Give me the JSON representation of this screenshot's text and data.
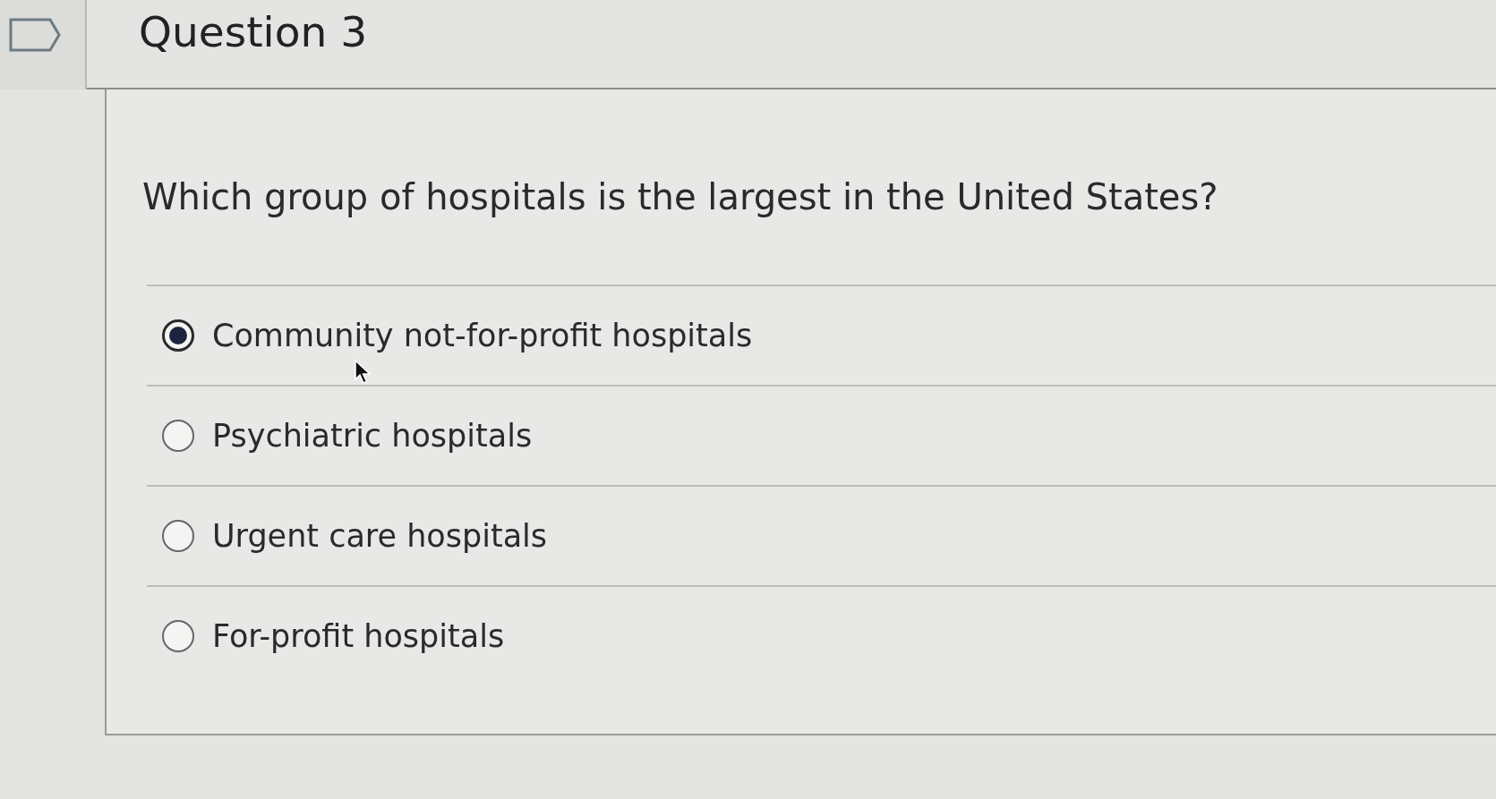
{
  "question": {
    "title": "Question 3",
    "text": "Which group of hospitals is the largest in the United States?"
  },
  "options": [
    {
      "label": "Community not-for-profit hospitals",
      "selected": true
    },
    {
      "label": "Psychiatric hospitals",
      "selected": false
    },
    {
      "label": "Urgent care hospitals",
      "selected": false
    },
    {
      "label": "For-profit hospitals",
      "selected": false
    }
  ]
}
